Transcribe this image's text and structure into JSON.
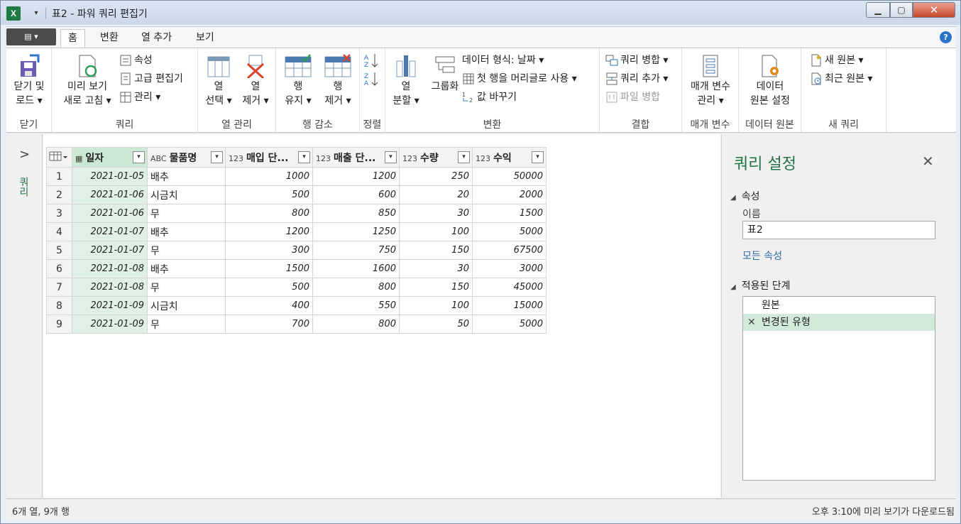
{
  "window": {
    "app_icon": "X",
    "title": "표2 - 파워 쿼리 편집기"
  },
  "tabs": [
    {
      "label": "홈"
    },
    {
      "label": "변환"
    },
    {
      "label": "열 추가"
    },
    {
      "label": "보기"
    }
  ],
  "ribbon": {
    "close": {
      "line1": "닫기 및",
      "line2": "로드 ▾",
      "group": "닫기"
    },
    "query": {
      "refresh_line1": "미리 보기",
      "refresh_line2": "새로 고침 ▾",
      "properties": "속성",
      "advanced_editor": "고급 편집기",
      "manage": "관리 ▾",
      "group": "쿼리"
    },
    "columns": {
      "choose_line1": "열",
      "choose_line2": "선택 ▾",
      "remove_line1": "열",
      "remove_line2": "제거 ▾",
      "group": "열 관리"
    },
    "rows": {
      "keep_line1": "행",
      "keep_line2": "유지 ▾",
      "remove_line1": "행",
      "remove_line2": "제거 ▾",
      "group": "행 감소"
    },
    "sort": {
      "group": "정렬"
    },
    "transform": {
      "split_line1": "열",
      "split_line2": "분할 ▾",
      "group_by": "그룹화",
      "data_type": "데이터 형식: 날짜 ▾",
      "first_row_header": "첫 행을 머리글로 사용 ▾",
      "replace_values": "값 바꾸기",
      "group": "변환"
    },
    "combine": {
      "merge_queries": "쿼리 병합 ▾",
      "append_queries": "쿼리 추가 ▾",
      "combine_files": "파일 병합",
      "group": "결합"
    },
    "parameters": {
      "line1": "매개 변수",
      "line2": "관리 ▾",
      "group": "매개 변수"
    },
    "datasource": {
      "line1": "데이터",
      "line2": "원본 설정",
      "group": "데이터 원본"
    },
    "newquery": {
      "new_source": "새 원본 ▾",
      "recent_sources": "최근 원본 ▾",
      "group": "새 쿼리"
    }
  },
  "left_pane": {
    "label": "쿼리"
  },
  "table": {
    "columns": [
      {
        "type": "▦",
        "name": "일자"
      },
      {
        "type": "ABC",
        "name": "물품명"
      },
      {
        "type": "123",
        "name": "매입 단..."
      },
      {
        "type": "123",
        "name": "매출 단..."
      },
      {
        "type": "123",
        "name": "수량"
      },
      {
        "type": "123",
        "name": "수익"
      }
    ],
    "rows": [
      [
        "1",
        "2021-01-05",
        "배추",
        "1000",
        "1200",
        "250",
        "50000"
      ],
      [
        "2",
        "2021-01-06",
        "시금치",
        "500",
        "600",
        "20",
        "2000"
      ],
      [
        "3",
        "2021-01-06",
        "무",
        "800",
        "850",
        "30",
        "1500"
      ],
      [
        "4",
        "2021-01-07",
        "배추",
        "1200",
        "1250",
        "100",
        "5000"
      ],
      [
        "5",
        "2021-01-07",
        "무",
        "300",
        "750",
        "150",
        "67500"
      ],
      [
        "6",
        "2021-01-08",
        "배추",
        "1500",
        "1600",
        "30",
        "3000"
      ],
      [
        "7",
        "2021-01-08",
        "무",
        "500",
        "800",
        "150",
        "45000"
      ],
      [
        "8",
        "2021-01-09",
        "시금치",
        "400",
        "550",
        "100",
        "15000"
      ],
      [
        "9",
        "2021-01-09",
        "무",
        "700",
        "800",
        "50",
        "5000"
      ]
    ]
  },
  "query_settings": {
    "title": "쿼리 설정",
    "properties_section": "속성",
    "name_label": "이름",
    "name_value": "표2",
    "all_properties": "모든 속성",
    "applied_steps_section": "적용된 단계",
    "steps": [
      {
        "label": "원본"
      },
      {
        "label": "변경된 유형"
      }
    ]
  },
  "status": {
    "left": "6개 열, 9개 행",
    "right": "오후 3:10에 미리 보기가 다운로드됨"
  },
  "colors": {
    "accent": "#217346",
    "selected_step": "#d2ead9",
    "date_column": "#dff1e4"
  }
}
